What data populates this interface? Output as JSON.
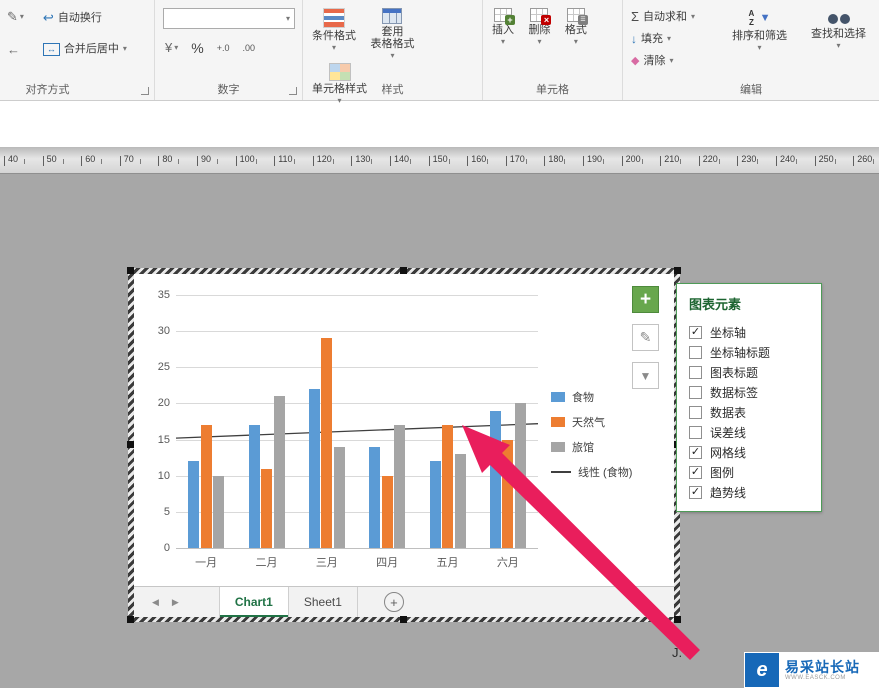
{
  "colors": {
    "excel_green": "#217346",
    "arrow": "#E91E5C",
    "series_blue": "#5B9BD5",
    "series_orange": "#ED7D31",
    "series_gray": "#A5A5A5"
  },
  "icons": {
    "caret": "▾",
    "plus": "+",
    "check": "✓",
    "sigma": "Σ",
    "fill_down": "↓",
    "clear": "◆",
    "pencil": "✎",
    "brush": "✎",
    "funnel": "▼",
    "wrap": "↩",
    "merge_arrows": "↔",
    "currency": "¥",
    "nav_left": "◀",
    "nav_right": "▶",
    "add_sheet": "+",
    "indent": "←",
    "sort_letters": "A\nZ",
    "logo": "e"
  },
  "ribbon": {
    "groups": [
      {
        "label": "对齐方式"
      },
      {
        "label": "数字"
      },
      {
        "label": "样式"
      },
      {
        "label": "单元格"
      },
      {
        "label": "编辑"
      }
    ],
    "alignment": {
      "wrap_text": "自动换行",
      "merge_center": "合并后居中"
    },
    "number": {
      "percent": "%",
      "increase_decimal": "+.0",
      "decrease_decimal": ".00"
    },
    "styles": {
      "conditional": "条件格式",
      "format_table": "套用\n表格格式",
      "cell_styles": "单元格样式"
    },
    "cells": {
      "insert": "插入",
      "delete": "删除",
      "format": "格式"
    },
    "editing": {
      "autosum": "自动求和",
      "fill": "填充",
      "clear": "清除",
      "sort_filter": "排序和筛选",
      "find_select": "查找和选择"
    }
  },
  "ruler": {
    "labels": [
      "40",
      "50",
      "60",
      "70",
      "80",
      "90",
      "100",
      "110",
      "120",
      "130",
      "140",
      "150",
      "160",
      "170",
      "180",
      "190",
      "200",
      "210",
      "220",
      "230",
      "240",
      "250",
      "260"
    ]
  },
  "chart_data": {
    "type": "bar",
    "title": "",
    "categories": [
      "一月",
      "二月",
      "三月",
      "四月",
      "五月",
      "六月"
    ],
    "series": [
      {
        "name": "食物",
        "color": "#5B9BD5",
        "values": [
          12,
          17,
          22,
          14,
          12,
          19
        ]
      },
      {
        "name": "天然气",
        "color": "#ED7D31",
        "values": [
          17,
          11,
          29,
          10,
          17,
          15
        ]
      },
      {
        "name": "旅馆",
        "color": "#A5A5A5",
        "values": [
          10,
          21,
          14,
          17,
          13,
          20
        ]
      }
    ],
    "trendline": {
      "name": "线性 (食物)",
      "start": 15.2,
      "end": 17.2
    },
    "ylim": [
      0,
      35
    ],
    "ytick_step": 5,
    "grid": true,
    "legend_position": "right"
  },
  "chart_elements_panel": {
    "title": "图表元素",
    "items": [
      {
        "label": "坐标轴",
        "checked": true
      },
      {
        "label": "坐标轴标题",
        "checked": false
      },
      {
        "label": "图表标题",
        "checked": false
      },
      {
        "label": "数据标签",
        "checked": false
      },
      {
        "label": "数据表",
        "checked": false
      },
      {
        "label": "误差线",
        "checked": false
      },
      {
        "label": "网格线",
        "checked": true
      },
      {
        "label": "图例",
        "checked": true
      },
      {
        "label": "趋势线",
        "checked": true
      }
    ]
  },
  "sheet_bar": {
    "tabs": [
      {
        "label": "Chart1",
        "active": true
      },
      {
        "label": "Sheet1",
        "active": false
      }
    ]
  },
  "watermark": {
    "title": "易采站长站",
    "subtitle": "WWW.EASCK.COM"
  },
  "floating_text": "J."
}
